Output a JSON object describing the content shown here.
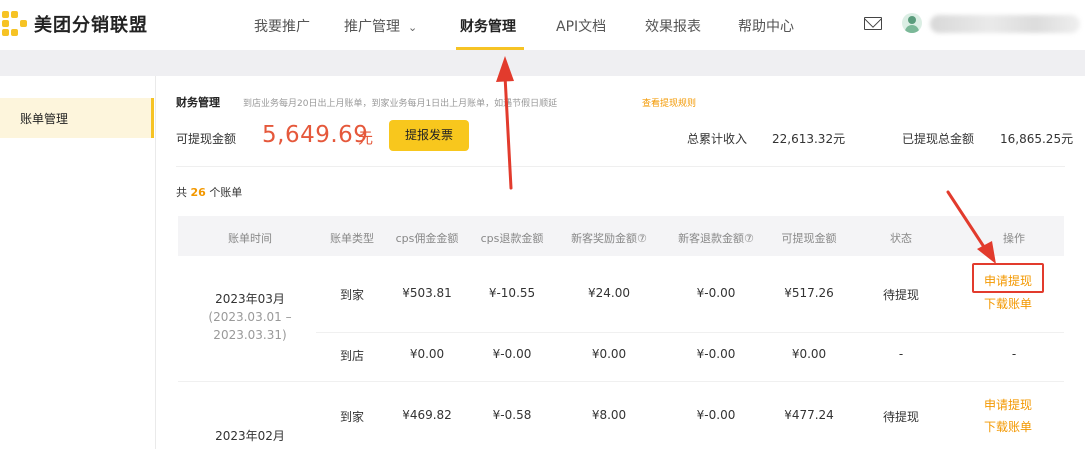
{
  "header": {
    "logo_text": "美团分销联盟",
    "nav": [
      {
        "label": "我要推广",
        "active": false
      },
      {
        "label": "推广管理",
        "active": false,
        "has_dropdown": true
      },
      {
        "label": "财务管理",
        "active": true
      },
      {
        "label": "API文档",
        "active": false
      },
      {
        "label": "效果报表",
        "active": false
      },
      {
        "label": "帮助中心",
        "active": false
      }
    ],
    "icons": [
      "mail-icon",
      "avatar"
    ]
  },
  "sidebar": {
    "items": [
      {
        "label": "账单管理",
        "active": true
      }
    ]
  },
  "finance": {
    "title": "财务管理",
    "note": "到店业务每月20日出上月账单，到家业务每月1日出上月账单，如遇节假日顺延",
    "rules_link": "查看提现规则",
    "withdrawable_label": "可提现金额",
    "withdrawable_amount": "5,649.69",
    "withdrawable_unit": "元",
    "invoice_button": "提报发票",
    "total_income_label": "总累计收入",
    "total_income_value": "22,613.32元",
    "withdrawn_label": "已提现总金额",
    "withdrawn_value": "16,865.25元"
  },
  "bills": {
    "count_prefix": "共",
    "count": "26",
    "count_suffix": "个账单",
    "columns": [
      "账单时间",
      "账单类型",
      "cps佣金金额",
      "cps退款金额",
      "新客奖励金额⑦",
      "新客退款金额⑦",
      "可提现金额",
      "状态",
      "操作"
    ],
    "groups": [
      {
        "month": "2023年03月",
        "range_start": "(2023.03.01 –",
        "range_end": "2023.03.31)",
        "rows": [
          {
            "type": "到家",
            "cps_commission": "¥503.81",
            "cps_refund": "¥-10.55",
            "new_reward": "¥24.00",
            "new_refund": "¥-0.00",
            "withdrawable": "¥517.26",
            "status": "待提现",
            "action_apply": "申请提现",
            "action_download": "下载账单"
          },
          {
            "type": "到店",
            "cps_commission": "¥0.00",
            "cps_refund": "¥-0.00",
            "new_reward": "¥0.00",
            "new_refund": "¥-0.00",
            "withdrawable": "¥0.00",
            "status": "-",
            "action_apply": "",
            "action_download": "-"
          }
        ]
      },
      {
        "month": "2023年02月",
        "rows": [
          {
            "type": "到家",
            "cps_commission": "¥469.82",
            "cps_refund": "¥-0.58",
            "new_reward": "¥8.00",
            "new_refund": "¥-0.00",
            "withdrawable": "¥477.24",
            "status": "待提现",
            "action_apply": "申请提现",
            "action_download": "下载账单"
          }
        ]
      }
    ]
  },
  "colors": {
    "brand_yellow": "#f6c324",
    "amount_red": "#e5583b",
    "link_orange": "#f39800",
    "annotation_red": "#e23b2d"
  }
}
